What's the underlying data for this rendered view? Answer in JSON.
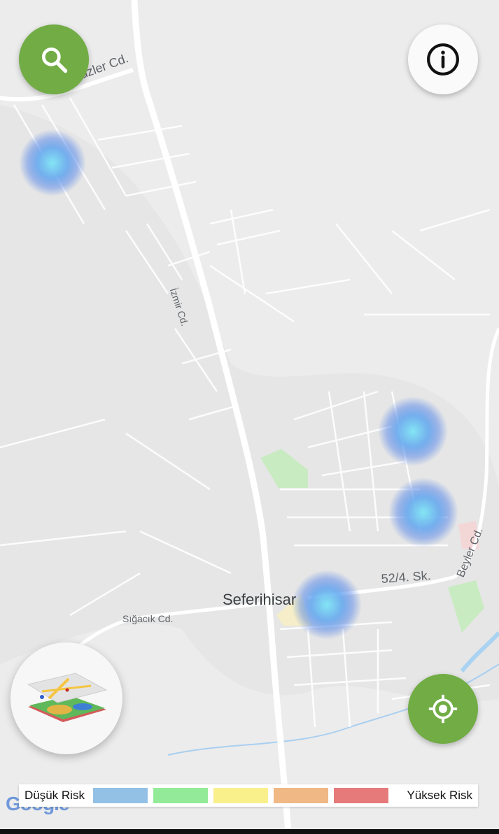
{
  "map": {
    "town_label": "Seferihisar",
    "streets": {
      "gozsuzler": "Gözsüzler Cd.",
      "izmir": "İzmir Cd.",
      "beyler": "Beyler Cd.",
      "sk52": "52/4. Sk.",
      "sigacik": "Sığacık Cd."
    },
    "attribution": "Google",
    "heat_color": "#6fa8f0"
  },
  "legend": {
    "low_label": "Düşük Risk",
    "high_label": "Yüksek Risk",
    "colors": [
      "#93c1e6",
      "#93eb9a",
      "#f9f08c",
      "#efb885",
      "#e67a7a"
    ]
  },
  "buttons": {
    "search_icon": "search-icon",
    "info_icon": "info-icon",
    "locate_icon": "my-location-icon",
    "layers_icon": "map-layers-icon"
  }
}
